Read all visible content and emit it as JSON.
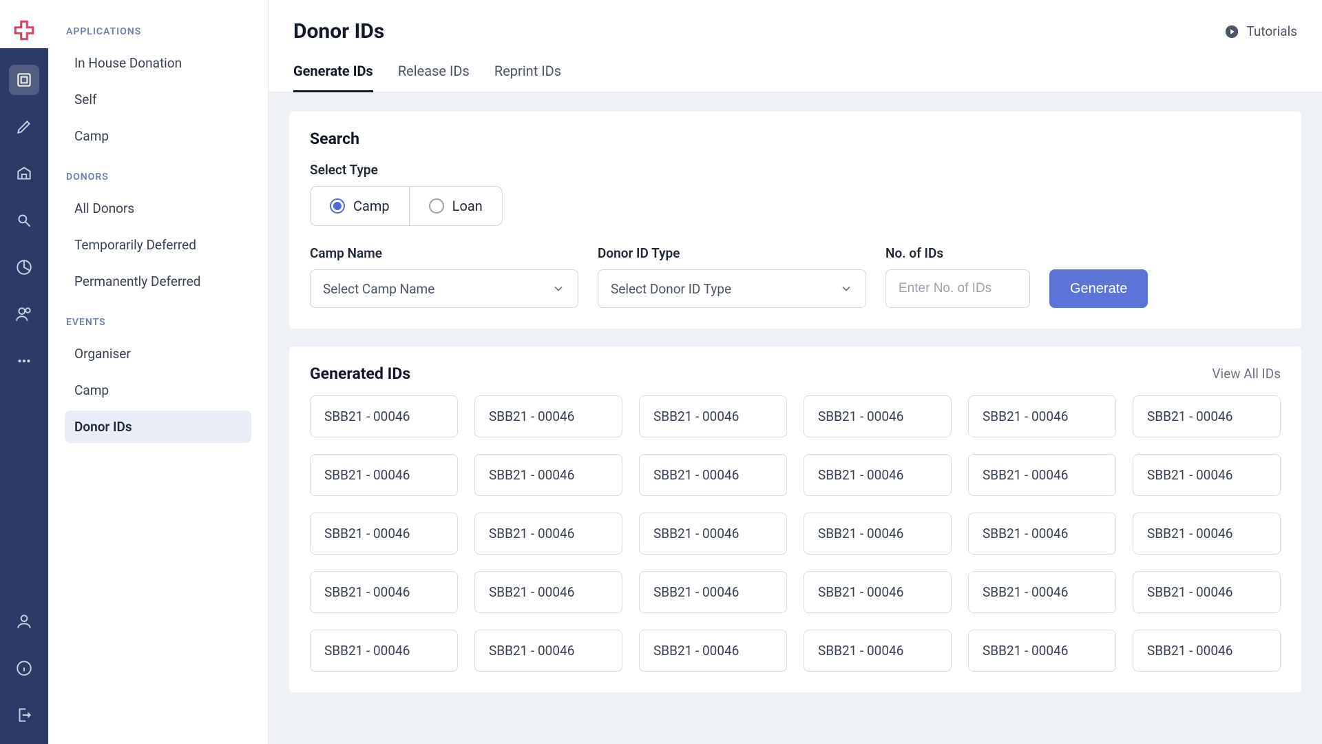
{
  "sidebar": {
    "groups": [
      {
        "title": "APPLICATIONS",
        "items": [
          {
            "label": "In House Donation",
            "active": false
          },
          {
            "label": "Self",
            "active": false
          },
          {
            "label": "Camp",
            "active": false
          }
        ]
      },
      {
        "title": "DONORS",
        "items": [
          {
            "label": "All Donors",
            "active": false
          },
          {
            "label": "Temporarily Deferred",
            "active": false
          },
          {
            "label": "Permanently Deferred",
            "active": false
          }
        ]
      },
      {
        "title": "EVENTS",
        "items": [
          {
            "label": "Organiser",
            "active": false
          },
          {
            "label": "Camp",
            "active": false
          },
          {
            "label": "Donor IDs",
            "active": true
          }
        ]
      }
    ]
  },
  "header": {
    "title": "Donor IDs",
    "tutorials": "Tutorials"
  },
  "tabs": [
    {
      "label": "Generate IDs",
      "active": true
    },
    {
      "label": "Release IDs",
      "active": false
    },
    {
      "label": "Reprint IDs",
      "active": false
    }
  ],
  "search": {
    "title": "Search",
    "select_type_label": "Select Type",
    "radios": [
      {
        "label": "Camp",
        "selected": true
      },
      {
        "label": "Loan",
        "selected": false
      }
    ],
    "camp_name": {
      "label": "Camp Name",
      "placeholder": "Select Camp Name"
    },
    "donor_id_type": {
      "label": "Donor ID Type",
      "placeholder": "Select Donor ID Type"
    },
    "no_of_ids": {
      "label": "No. of IDs",
      "placeholder": "Enter No. of IDs"
    },
    "generate_btn": "Generate"
  },
  "generated": {
    "title": "Generated IDs",
    "view_all": "View All IDs",
    "ids": [
      "SBB21 - 00046",
      "SBB21 - 00046",
      "SBB21 - 00046",
      "SBB21 - 00046",
      "SBB21 - 00046",
      "SBB21 - 00046",
      "SBB21 - 00046",
      "SBB21 - 00046",
      "SBB21 - 00046",
      "SBB21 - 00046",
      "SBB21 - 00046",
      "SBB21 - 00046",
      "SBB21 - 00046",
      "SBB21 - 00046",
      "SBB21 - 00046",
      "SBB21 - 00046",
      "SBB21 - 00046",
      "SBB21 - 00046",
      "SBB21 - 00046",
      "SBB21 - 00046",
      "SBB21 - 00046",
      "SBB21 - 00046",
      "SBB21 - 00046",
      "SBB21 - 00046",
      "SBB21 - 00046",
      "SBB21 - 00046",
      "SBB21 - 00046",
      "SBB21 - 00046",
      "SBB21 - 00046",
      "SBB21 - 00046"
    ]
  },
  "colors": {
    "accent": "#5a74d8",
    "rail": "#2b3a67"
  }
}
